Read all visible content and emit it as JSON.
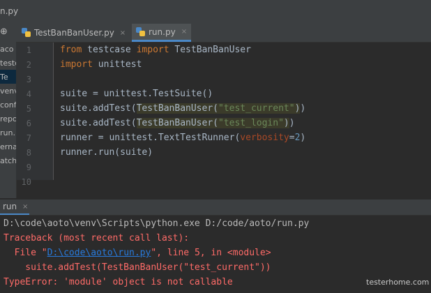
{
  "window": {
    "title": "n.py"
  },
  "sidebar": {
    "items": [
      {
        "label": "aco D:"
      },
      {
        "label": "testc"
      },
      {
        "label": "Te"
      },
      {
        "label": "venv"
      },
      {
        "label": "confi"
      },
      {
        "label": "repo"
      },
      {
        "label": "run.p"
      },
      {
        "label": "ernal"
      },
      {
        "label": "atche"
      }
    ]
  },
  "tabs": [
    {
      "label": "TestBanBanUser.py",
      "close": "×"
    },
    {
      "label": "run.py",
      "close": "×"
    }
  ],
  "editor": {
    "line_numbers": [
      "1",
      "2",
      "3",
      "4",
      "5",
      "6",
      "7",
      "8",
      "9",
      "10"
    ],
    "code": {
      "l1": {
        "kw_from": "from",
        "mod": " testcase ",
        "kw_import": "import",
        "name": " TestBanBanUser"
      },
      "l2": {
        "kw_import": "import",
        "mod": " unittest"
      },
      "l4": {
        "text": "suite = unittest.TestSuite()"
      },
      "l5": {
        "pre": "suite.addTest(",
        "cls": "TestBanBanUser(",
        "str": "\"test_current\"",
        "close1": ")",
        "close2": ")"
      },
      "l6": {
        "pre": "suite.addTest(",
        "cls": "TestBanBanUser(",
        "str": "\"test_login\"",
        "close1": ")",
        "close2": ")"
      },
      "l7": {
        "pre": "runner = unittest.TextTestRunner(",
        "param": "verbosity",
        "eq": "=",
        "num": "2",
        "close": ")"
      },
      "l8": {
        "text": "runner.run(suite)"
      }
    }
  },
  "run_panel": {
    "label": "run",
    "close": "×"
  },
  "console": {
    "cmd": "D:\\code\\aoto\\venv\\Scripts\\python.exe D:/code/aoto/run.py",
    "traceback": "Traceback (most recent call last):",
    "file_prefix": "  File \"",
    "file_link": "D:\\code\\aoto\\run.py",
    "file_suffix": "\", line 5, in <module>",
    "code_line": "    suite.addTest(TestBanBanUser(\"test_current\"))",
    "error": "TypeError: 'module' object is not callable"
  },
  "watermark": "testerhome.com"
}
